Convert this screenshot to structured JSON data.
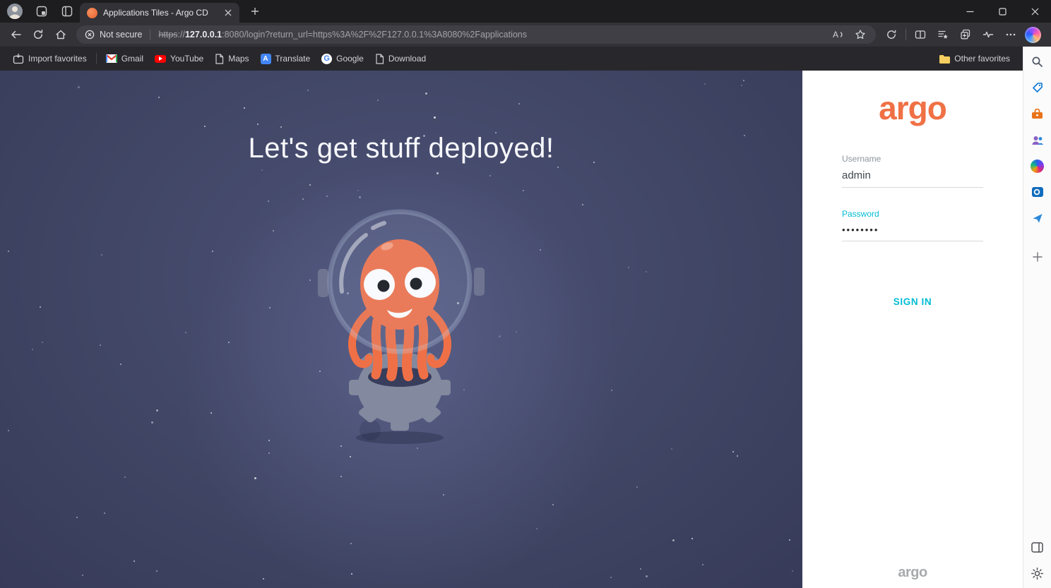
{
  "colors": {
    "argo_orange": "#EF7145",
    "argo_teal": "#00BCD4",
    "space_background": "#424767",
    "panel_white": "#FFFFFF"
  },
  "titlebar": {
    "tab_title": "Applications Tiles - Argo CD"
  },
  "navbar": {
    "security_label": "Not secure",
    "url_scheme": "https",
    "url_separator": "://",
    "url_host": "127.0.0.1",
    "url_rest": ":8080/login?return_url=https%3A%2F%2F127.0.0.1%3A8080%2Fapplications"
  },
  "favorites_bar": {
    "import_label": "Import favorites",
    "items": [
      {
        "label": "Gmail"
      },
      {
        "label": "YouTube"
      },
      {
        "label": "Maps"
      },
      {
        "label": "Translate"
      },
      {
        "label": "Google"
      },
      {
        "label": "Download"
      }
    ],
    "other_favorites_label": "Other favorites"
  },
  "page": {
    "headline": "Let's get stuff deployed!",
    "login": {
      "logo_text": "argo",
      "username_label": "Username",
      "username_value": "admin",
      "password_label": "Password",
      "password_masked_value": "••••••••",
      "sign_in_label": "SIGN IN",
      "footer_logo_text": "argo"
    }
  }
}
